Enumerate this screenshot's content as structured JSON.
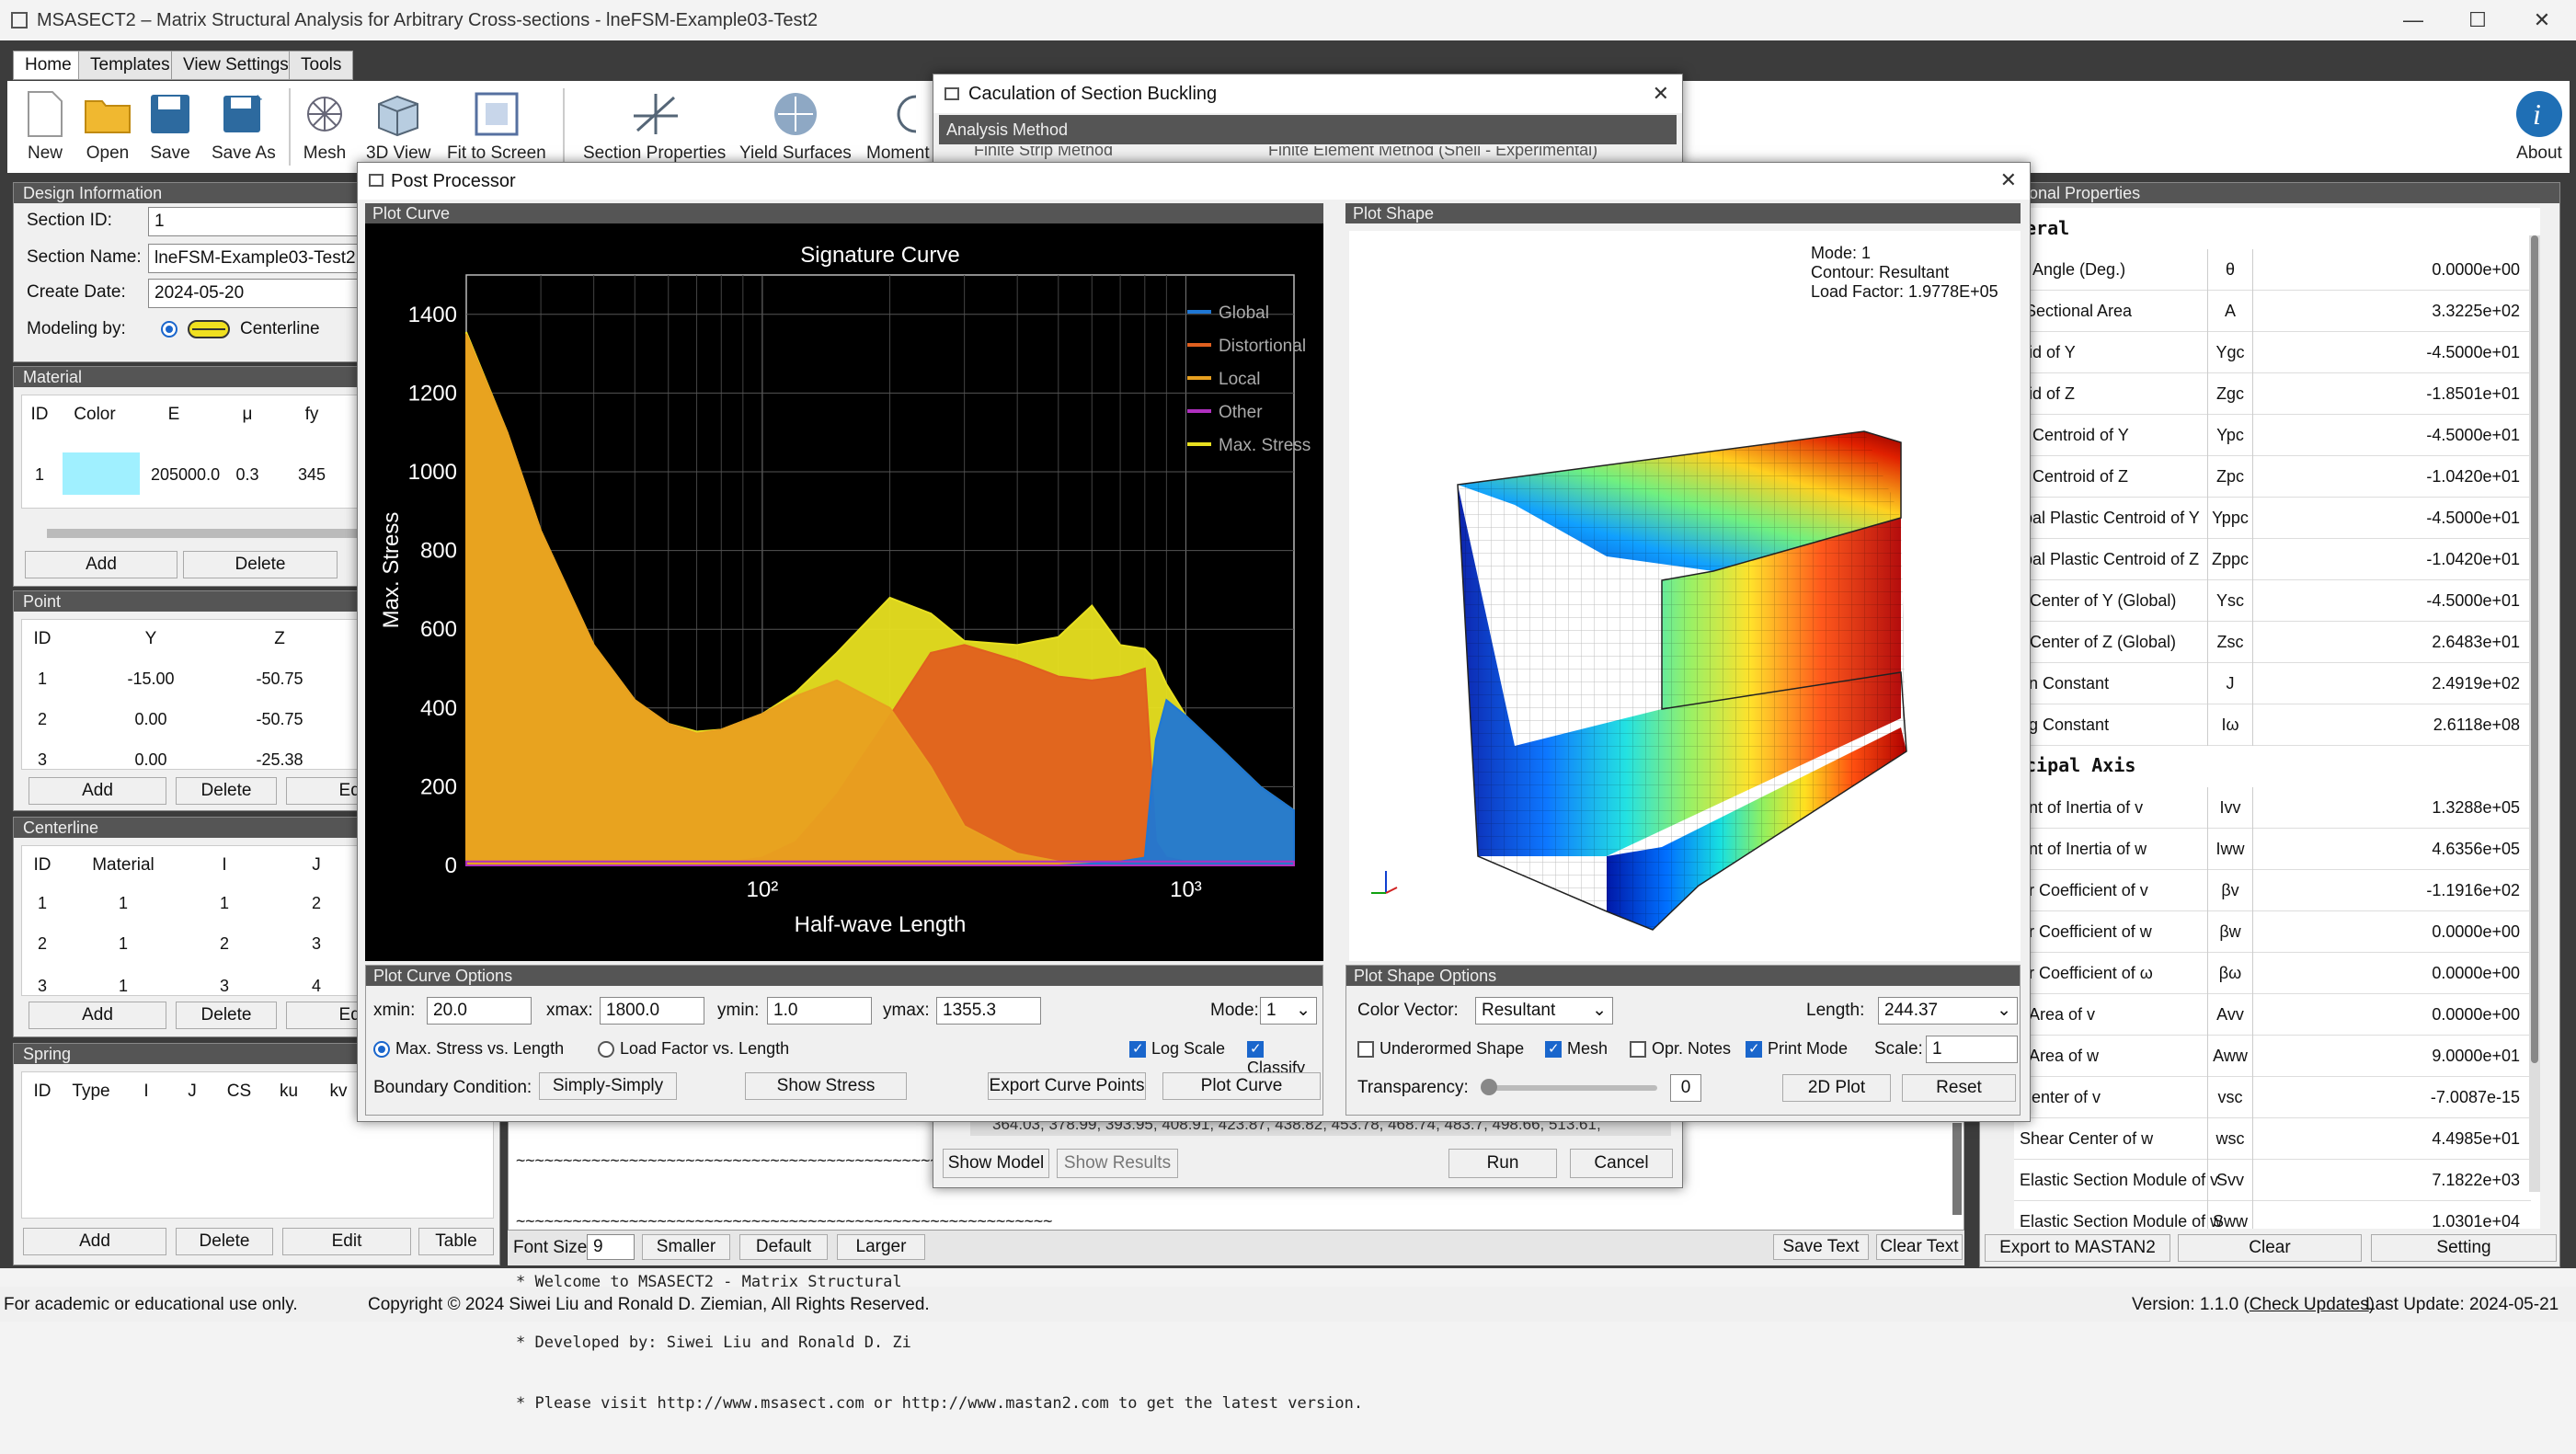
{
  "window": {
    "title": "MSASECT2 – Matrix Structural Analysis for Arbitrary Cross-sections - lneFSM-Example03-Test2",
    "min": "—",
    "max": "☐",
    "close": "✕"
  },
  "menu": {
    "tabs": [
      "Home",
      "Templates",
      "View Settings",
      "Tools"
    ]
  },
  "ribbon": {
    "buttons": [
      "New",
      "Open",
      "Save",
      "Save As",
      "Mesh",
      "3D View",
      "Fit to Screen",
      "Section Properties",
      "Yield Surfaces",
      "Moment C"
    ],
    "about": "About"
  },
  "design": {
    "header": "Design Information",
    "section_id_label": "Section ID:",
    "section_id": "1",
    "section_name_label": "Section Name:",
    "section_name": "lneFSM-Example03-Test2",
    "create_date_label": "Create Date:",
    "create_date": "2024-05-20",
    "modeling_label": "Modeling by:",
    "modeling_value": "Centerline"
  },
  "material": {
    "header": "Material",
    "cols": [
      "ID",
      "Color",
      "E",
      "μ",
      "fy"
    ],
    "row": [
      "1",
      "",
      "205000.0",
      "0.3",
      "345"
    ],
    "add": "Add",
    "delete": "Delete"
  },
  "point": {
    "header": "Point",
    "cols": [
      "ID",
      "Y",
      "Z"
    ],
    "rows": [
      [
        "1",
        "-15.00",
        "-50.75"
      ],
      [
        "2",
        "0.00",
        "-50.75"
      ],
      [
        "3",
        "0.00",
        "-25.38"
      ]
    ],
    "add": "Add",
    "delete": "Delete",
    "edit": "Edi"
  },
  "centerline": {
    "header": "Centerline",
    "cols": [
      "ID",
      "Material",
      "I",
      "J"
    ],
    "rows": [
      [
        "1",
        "1",
        "1",
        "2"
      ],
      [
        "2",
        "1",
        "2",
        "3"
      ],
      [
        "3",
        "1",
        "3",
        "4"
      ]
    ],
    "add": "Add",
    "delete": "Delete",
    "edit": "Edi"
  },
  "spring": {
    "header": "Spring",
    "cols": [
      "ID",
      "Type",
      "I",
      "J",
      "CS",
      "ku",
      "kv"
    ],
    "add": "Add",
    "delete": "Delete",
    "edit": "Edit",
    "table": "Table"
  },
  "buckling": {
    "title": "Caculation of Section Buckling",
    "group": "Analysis Method",
    "opt1": "Finite Strip Method",
    "opt2": "Finite Element Method (Shell - Experimental)",
    "lengths": "364.03, 378.99, 393.95, 408.91, 423.87, 438.82, 453.78, 468.74, 483.7, 498.66, 513.61,",
    "show_model": "Show Model",
    "show_results": "Show Results",
    "run": "Run",
    "cancel": "Cancel"
  },
  "console": {
    "lines": [
      "~~~~~~~~~~~~~~~~~~~~~~~~~~~~~~~~~~~~~~~~~~~~~~~~~~~~~~~~~",
      "~~~~~~~~~~~~~~~~~~~~~~~~~~~~~~~~~~~~~~~~~~~~~~~~~~~~~~~~~",
      "* Welcome to MSASECT2 - Matrix Structural",
      "* Developed by: Siwei Liu and Ronald D. Zi",
      "* Please visit http://www.msasect.com or http://www.mastan2.com to get the latest version."
    ],
    "font_size_label": "Font Size",
    "font_size": "9",
    "smaller": "Smaller",
    "default": "Default",
    "larger": "Larger",
    "save_text": "Save Text",
    "clear_text": "Clear Text"
  },
  "props": {
    "header": "-sectional Properties",
    "general": "eral",
    "principal": "cipal Axis",
    "rows": [
      [
        "e Angle (Deg.)",
        "θ",
        "0.0000e+00"
      ],
      [
        "-Sectional Area",
        "A",
        "3.3225e+02"
      ],
      [
        "oid of Y",
        "Ygc",
        "-4.5000e+01"
      ],
      [
        "oid of Z",
        "Zgc",
        "-1.8501e+01"
      ],
      [
        "c Centroid of Y",
        "Ypc",
        "-4.5000e+01"
      ],
      [
        "c Centroid of Z",
        "Zpc",
        "-1.0420e+01"
      ],
      [
        "ipal Plastic Centroid of Y",
        "Yppc",
        "-4.5000e+01"
      ],
      [
        "ipal Plastic Centroid of Z",
        "Zppc",
        "-1.0420e+01"
      ],
      [
        "r Center of Y (Global)",
        "Ysc",
        "-4.5000e+01"
      ],
      [
        "r Center of Z (Global)",
        "Zsc",
        "2.6483e+01"
      ],
      [
        "on Constant",
        "J",
        "2.4919e+02"
      ],
      [
        "ng Constant",
        "Iω",
        "2.6118e+08"
      ]
    ],
    "rows2": [
      [
        "ent of Inertia of v",
        "Ivv",
        "1.3288e+05"
      ],
      [
        "ent of Inertia of w",
        "Iww",
        "4.6356e+05"
      ],
      [
        "er Coefficient of v",
        "βv",
        "-1.1916e+02"
      ],
      [
        "er Coefficient of w",
        "βw",
        "0.0000e+00"
      ],
      [
        "er Coefficient of ω",
        "βω",
        "0.0000e+00"
      ],
      [
        "r Area of v",
        "Avv",
        "0.0000e+00"
      ],
      [
        "r Area of w",
        "Aww",
        "9.0000e+01"
      ],
      [
        "Center of v",
        "vsc",
        "-7.0087e-15"
      ],
      [
        "Shear Center of w",
        "wsc",
        "4.4985e+01"
      ],
      [
        "Elastic Section Module of v",
        "Svv",
        "7.1822e+03"
      ],
      [
        "Elastic Section Module of w",
        "Sww",
        "1.0301e+04"
      ]
    ],
    "export": "Export to MASTAN2",
    "clear": "Clear",
    "setting": "Setting"
  },
  "post": {
    "title": "Post Processor",
    "plot_curve": "Plot Curve",
    "plot_shape": "Plot Shape",
    "curve_options": "Plot Curve Options",
    "shape_options": "Plot Shape Options",
    "xmin_label": "xmin:",
    "xmin": "20.0",
    "xmax_label": "xmax:",
    "xmax": "1800.0",
    "ymin_label": "ymin:",
    "ymin": "1.0",
    "ymax_label": "ymax:",
    "ymax": "1355.3",
    "mode_label": "Mode:",
    "mode": "1",
    "radio1": "Max. Stress vs. Length",
    "radio2": "Load Factor vs. Length",
    "log_scale": "Log Scale",
    "classify": "Classify",
    "bc_label": "Boundary Condition:",
    "bc": "Simply-Simply",
    "show_stress": "Show Stress",
    "export_points": "Export Curve Points",
    "plot_curve_btn": "Plot Curve",
    "color_vector_label": "Color Vector:",
    "color_vector": "Resultant",
    "length_label": "Length:",
    "length": "244.37",
    "undeformed": "Underormed Shape",
    "mesh": "Mesh",
    "opr_notes": "Opr. Notes",
    "print_mode": "Print Mode",
    "scale_label": "Scale:",
    "scale": "1",
    "transparency_label": "Transparency:",
    "transparency": "0",
    "plot2d": "2D Plot",
    "reset": "Reset",
    "shape_info": [
      "Mode: 1",
      "Contour: Resultant",
      "Load Factor: 1.9778E+05"
    ]
  },
  "chart_data": {
    "type": "area",
    "title": "Signature Curve",
    "xlabel": "Half-wave Length",
    "ylabel": "Max. Stress",
    "xscale": "log",
    "xlim": [
      20,
      1800
    ],
    "ylim": [
      0,
      1500
    ],
    "yticks": [
      0,
      200,
      400,
      600,
      800,
      1000,
      1200,
      1400
    ],
    "xticks": [
      "10²",
      "10³"
    ],
    "x": [
      20,
      25,
      30,
      40,
      50,
      60,
      70,
      80,
      100,
      120,
      150,
      200,
      250,
      300,
      400,
      500,
      600,
      700,
      800,
      850,
      900,
      1000,
      1200,
      1500,
      1800
    ],
    "series": [
      {
        "name": "Global",
        "color": "#1f77d4",
        "values": [
          0,
          0,
          0,
          0,
          0,
          0,
          0,
          0,
          0,
          0,
          0,
          0,
          0,
          0,
          0,
          0,
          5,
          10,
          20,
          320,
          420,
          380,
          300,
          200,
          140
        ]
      },
      {
        "name": "Distortional",
        "color": "#e0601f",
        "values": [
          0,
          0,
          0,
          0,
          0,
          0,
          0,
          5,
          20,
          60,
          180,
          380,
          540,
          560,
          520,
          480,
          470,
          480,
          500,
          60,
          20,
          10,
          5,
          5,
          0
        ]
      },
      {
        "name": "Local",
        "color": "#e8a020",
        "values": [
          1350,
          1100,
          850,
          560,
          420,
          360,
          335,
          345,
          385,
          430,
          470,
          400,
          250,
          100,
          30,
          10,
          5,
          0,
          0,
          0,
          0,
          0,
          0,
          0,
          0
        ]
      },
      {
        "name": "Other",
        "color": "#b030c0",
        "values": [
          10,
          10,
          10,
          10,
          10,
          10,
          10,
          10,
          10,
          10,
          10,
          10,
          10,
          10,
          10,
          10,
          10,
          10,
          10,
          10,
          10,
          10,
          10,
          10,
          10
        ]
      },
      {
        "name": "Max. Stress",
        "color": "#e8e020",
        "values": [
          1355,
          1100,
          850,
          560,
          420,
          360,
          340,
          345,
          385,
          440,
          540,
          680,
          640,
          570,
          560,
          580,
          660,
          560,
          550,
          520,
          460,
          380,
          300,
          200,
          140
        ]
      }
    ]
  },
  "status": {
    "left": "For academic or educational use only.",
    "copyright": "Copyright © 2024 Siwei Liu and Ronald D. Ziemian, All Rights Reserved.",
    "version": "Version: 1.1.0 (",
    "check": "Check Updates",
    "version_end": ")",
    "last_update": "Last Update: 2024-05-21"
  }
}
